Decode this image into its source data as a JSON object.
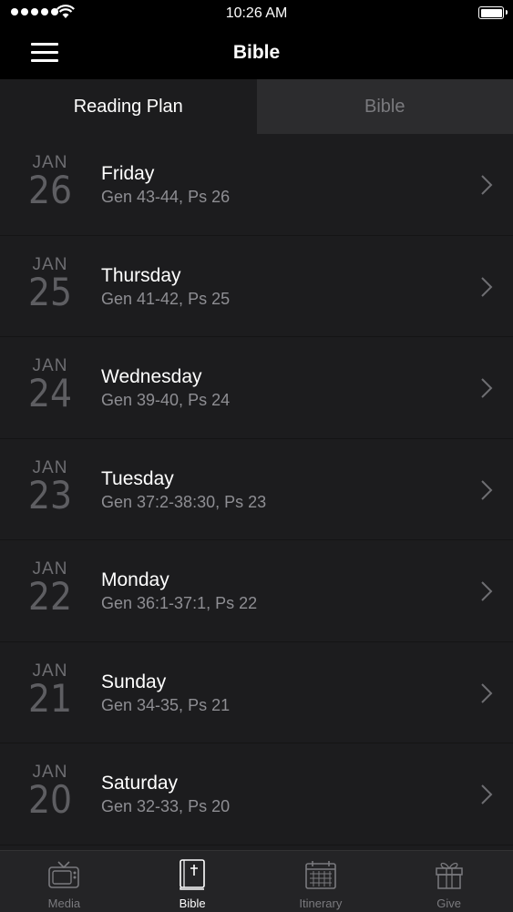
{
  "status_bar": {
    "time": "10:26 AM"
  },
  "nav": {
    "title": "Bible"
  },
  "segments": [
    {
      "label": "Reading Plan",
      "active": true
    },
    {
      "label": "Bible",
      "active": false
    }
  ],
  "readings": [
    {
      "month": "JAN",
      "day": "26",
      "weekday": "Friday",
      "passage": "Gen 43-44, Ps 26"
    },
    {
      "month": "JAN",
      "day": "25",
      "weekday": "Thursday",
      "passage": "Gen 41-42, Ps 25"
    },
    {
      "month": "JAN",
      "day": "24",
      "weekday": "Wednesday",
      "passage": "Gen 39-40, Ps 24"
    },
    {
      "month": "JAN",
      "day": "23",
      "weekday": "Tuesday",
      "passage": "Gen 37:2-38:30, Ps 23"
    },
    {
      "month": "JAN",
      "day": "22",
      "weekday": "Monday",
      "passage": "Gen 36:1-37:1, Ps 22"
    },
    {
      "month": "JAN",
      "day": "21",
      "weekday": "Sunday",
      "passage": "Gen 34-35, Ps 21"
    },
    {
      "month": "JAN",
      "day": "20",
      "weekday": "Saturday",
      "passage": "Gen 32-33, Ps 20"
    }
  ],
  "tabs": [
    {
      "label": "Media",
      "icon": "tv-icon",
      "active": false
    },
    {
      "label": "Bible",
      "icon": "bible-icon",
      "active": true
    },
    {
      "label": "Itinerary",
      "icon": "calendar-icon",
      "active": false
    },
    {
      "label": "Give",
      "icon": "gift-icon",
      "active": false
    }
  ]
}
